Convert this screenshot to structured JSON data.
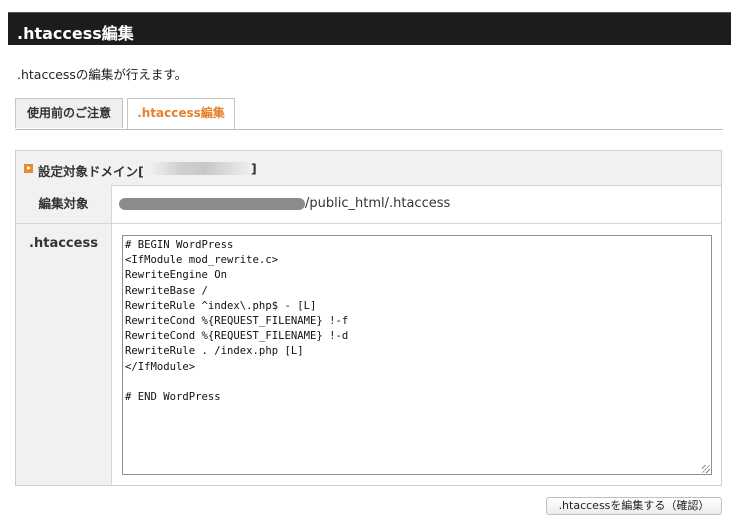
{
  "header": {
    "title": ".htaccess編集"
  },
  "description": ".htaccessの編集が行えます。",
  "tabs": [
    {
      "label": "使用前のご注意",
      "active": false
    },
    {
      "label": ".htaccess編集",
      "active": true
    }
  ],
  "panel": {
    "title": "設定対象ドメイン[",
    "title_close": "]",
    "target_label": "編集対象",
    "path_suffix": "/public_html/.htaccess",
    "htaccess_label": ".htaccess",
    "editor_content": "# BEGIN WordPress\n<IfModule mod_rewrite.c>\nRewriteEngine On\nRewriteBase /\nRewriteRule ^index\\.php$ - [L]\nRewriteCond %{REQUEST_FILENAME} !-f\nRewriteCond %{REQUEST_FILENAME} !-d\nRewriteRule . /index.php [L]\n</IfModule>\n\n# END WordPress"
  },
  "confirm_button": ".htaccessを編集する（確認）",
  "colors": {
    "header_bg": "#1c1c1c",
    "accent": "#e5822d"
  }
}
